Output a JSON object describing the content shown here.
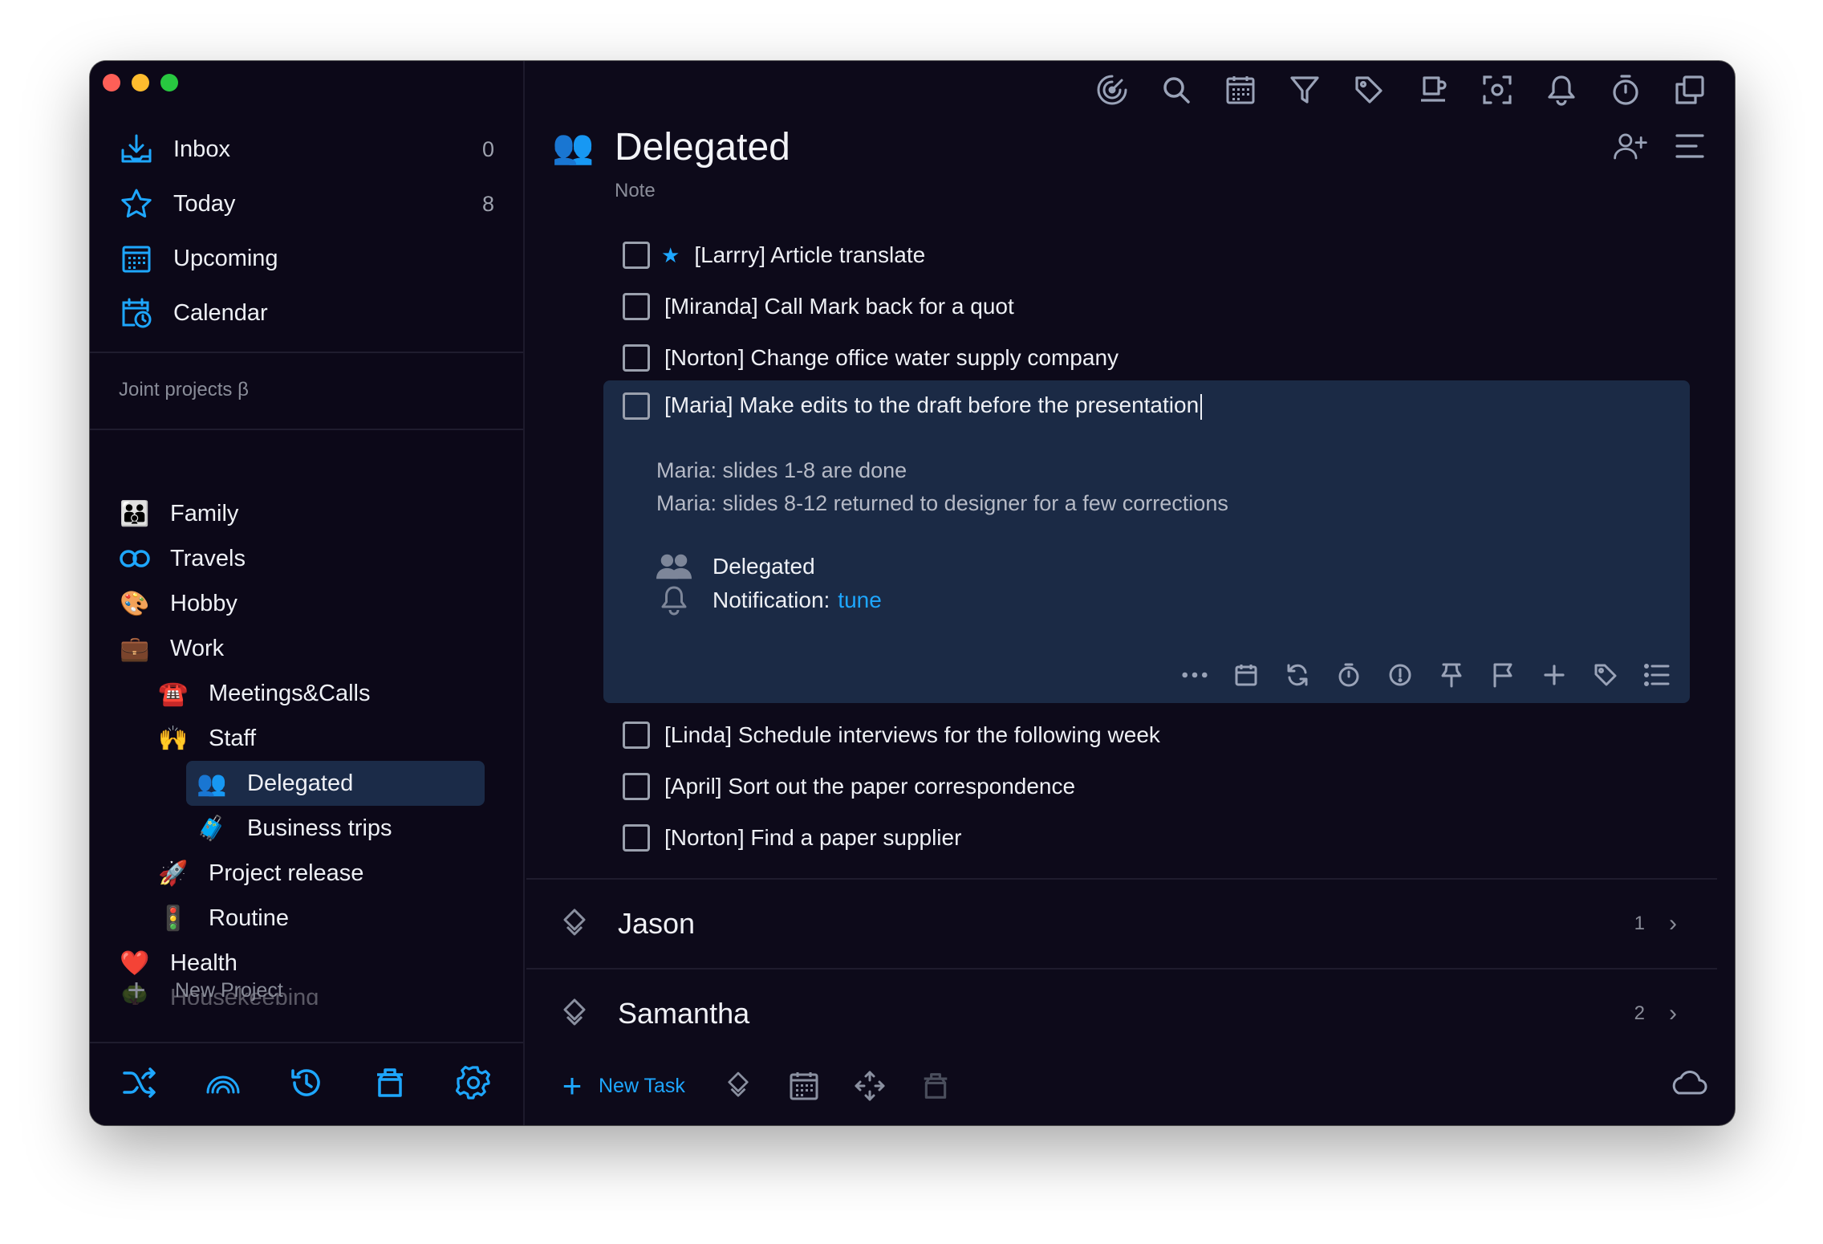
{
  "sidebar": {
    "nav": [
      {
        "label": "Inbox",
        "count": "0",
        "icon": "inbox-icon"
      },
      {
        "label": "Today",
        "count": "8",
        "icon": "star-icon"
      },
      {
        "label": "Upcoming",
        "count": "",
        "icon": "calendar-grid-icon"
      },
      {
        "label": "Calendar",
        "count": "",
        "icon": "calendar-clock-icon"
      }
    ],
    "joint_projects": "Joint projects β",
    "projects": [
      {
        "label": "Family",
        "emoji": "👪"
      },
      {
        "label": "Travels",
        "emoji": "∞"
      },
      {
        "label": "Hobby",
        "emoji": "🎨"
      },
      {
        "label": "Work",
        "emoji": "💼"
      },
      {
        "label": "Meetings&Calls",
        "emoji": "☎️"
      },
      {
        "label": "Staff",
        "emoji": "🙌"
      },
      {
        "label": "Delegated",
        "emoji": "👥"
      },
      {
        "label": "Business trips",
        "emoji": "🧳"
      },
      {
        "label": "Project release",
        "emoji": "🚀"
      },
      {
        "label": "Routine",
        "emoji": "🚦"
      },
      {
        "label": "Health",
        "emoji": "❤️"
      },
      {
        "label": "Housekeeping",
        "emoji": "🌳"
      }
    ],
    "new_project": "New Project",
    "bottom_icons": [
      "shuffle-icon",
      "rainbow-icon",
      "history-icon",
      "trash-icon",
      "gear-icon"
    ]
  },
  "toolbar_icons": [
    "focus-icon",
    "search-icon",
    "calendar-icon",
    "filter-icon",
    "tag-icon",
    "coffee-icon",
    "screenshot-icon",
    "bell-icon",
    "timer-icon",
    "duplicate-icon"
  ],
  "header": {
    "title": "Delegated",
    "note": "Note",
    "emoji": "👥"
  },
  "tasks": [
    {
      "label": "[Larrry] Article translate",
      "starred": true
    },
    {
      "label": "[Miranda] Call Mark back for a quot",
      "starred": false
    },
    {
      "label": "[Norton] Change office water supply company",
      "starred": false
    }
  ],
  "expanded_task": {
    "label": "[Maria] Make edits to the draft before the presentation",
    "notes": [
      "Maria: slides 1-8 are done",
      "Maria: slides 8-12 returned to designer for a few corrections"
    ],
    "project": "Delegated",
    "notification_label": "Notification:",
    "notification_value": "tune",
    "toolbar_icons": [
      "more-icon",
      "calendar-icon",
      "repeat-icon",
      "timer-icon",
      "priority-icon",
      "pin-icon",
      "flag-icon",
      "add-subtask-icon",
      "tag-icon",
      "checklist-icon"
    ]
  },
  "tasks_after": [
    {
      "label": "[Linda] Schedule interviews for the following week"
    },
    {
      "label": "[April] Sort out the paper correspondence"
    },
    {
      "label": "[Norton] Find a paper supplier"
    }
  ],
  "groups": [
    {
      "label": "Jason",
      "count": "1"
    },
    {
      "label": "Samantha",
      "count": "2"
    }
  ],
  "footer": {
    "new_task": "New Task"
  },
  "colors": {
    "accent": "#1ea7ff",
    "background": "#0d0a1a",
    "selected": "#1b2b48",
    "expanded": "#1b2a45"
  }
}
